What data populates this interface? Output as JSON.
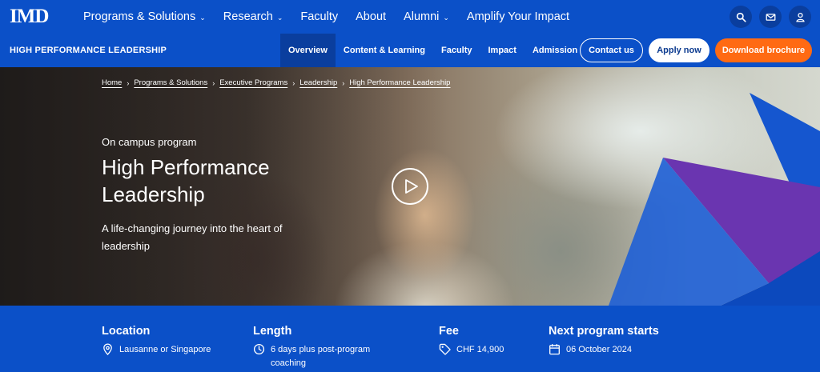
{
  "brand": {
    "logo": "IMD"
  },
  "top_menu": [
    {
      "label": "Programs & Solutions",
      "has_dropdown": true
    },
    {
      "label": "Research",
      "has_dropdown": true
    },
    {
      "label": "Faculty",
      "has_dropdown": false
    },
    {
      "label": "About",
      "has_dropdown": false
    },
    {
      "label": "Alumni",
      "has_dropdown": true
    },
    {
      "label": "Amplify Your Impact",
      "has_dropdown": false
    }
  ],
  "utility_icons": [
    "search-icon",
    "mail-icon",
    "user-icon"
  ],
  "subnav": {
    "program_title": "HIGH PERFORMANCE LEADERSHIP",
    "tabs": [
      {
        "label": "Overview",
        "active": true
      },
      {
        "label": "Content & Learning",
        "active": false
      },
      {
        "label": "Faculty",
        "active": false
      },
      {
        "label": "Impact",
        "active": false
      },
      {
        "label": "Admission",
        "active": false
      }
    ],
    "contact_label": "Contact us",
    "apply_label": "Apply now",
    "brochure_label": "Download brochure"
  },
  "breadcrumb": [
    "Home",
    "Programs & Solutions",
    "Executive Programs",
    "Leadership",
    "High Performance Leadership"
  ],
  "hero": {
    "eyebrow": "On campus program",
    "title": "High Performance Leadership",
    "subtitle": "A life-changing journey into the heart of leadership"
  },
  "info": {
    "location": {
      "heading": "Location",
      "value": "Lausanne or Singapore",
      "icon": "location-pin-icon"
    },
    "length": {
      "heading": "Length",
      "value": "6 days plus post-program coaching",
      "icon": "clock-icon"
    },
    "fee": {
      "heading": "Fee",
      "value": "CHF 14,900",
      "icon": "tag-icon"
    },
    "next_start": {
      "heading": "Next program starts",
      "value": "06 October 2024",
      "icon": "calendar-icon"
    }
  },
  "colors": {
    "primary_blue": "#0b50c8",
    "dark_blue": "#0a3e9e",
    "orange": "#ff6a13",
    "purple": "#6a35b0"
  }
}
